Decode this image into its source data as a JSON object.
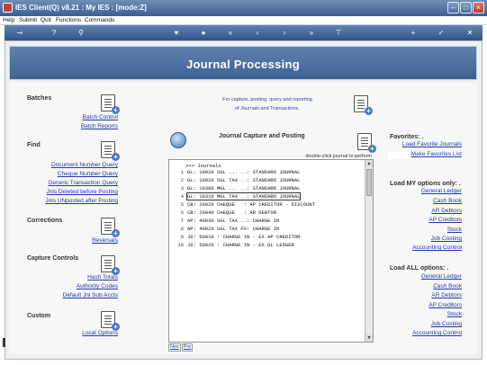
{
  "window": {
    "title": "IES Client(Q) v8.21 : My IES :       [mode:Z]",
    "controls": [
      "–",
      "□",
      "×"
    ]
  },
  "menu": [
    "Help",
    "Submit",
    "Quit",
    "Functions",
    "Commands"
  ],
  "toolbar": {
    "icons": [
      "key-icon",
      "help-icon",
      "search-icon",
      "heart-icon",
      "record-icon",
      "rewind-icon",
      "back-icon",
      "forward-icon",
      "fast-forward-icon",
      "skip-icon",
      "add-icon",
      "check-icon",
      "close-icon"
    ],
    "glyphs": [
      "⊸",
      "?",
      "⚲",
      "♥",
      "●",
      "«",
      "‹",
      "›",
      "»",
      "⊤",
      "+",
      "✓",
      "✕"
    ]
  },
  "banner": {
    "title": "Journal Processing"
  },
  "left": {
    "batches": {
      "title": "Batches",
      "links": [
        "Batch Control",
        "Batch Reports"
      ]
    },
    "find": {
      "title": "Find",
      "links": [
        "Document Number Query",
        "Cheque Number Query",
        "Generic Transaction Query",
        "Jnls Deleted before Posting",
        "Jnls UNposted after Posting"
      ]
    },
    "corrections": {
      "title": "Corrections",
      "links": [
        "Reversals"
      ]
    },
    "capture_controls": {
      "title": "Capture Controls",
      "links": [
        "Hash Totals",
        "Authority Codes",
        "Default Jnl Sub Accts"
      ]
    },
    "custom": {
      "title": "Custom",
      "links": [
        "Local Options"
      ]
    }
  },
  "center": {
    "info_line1": "For capture, posting, query and reporting",
    "info_line2": "of Journals and Transactions.",
    "capture_title": "Journal Capture and Posting",
    "hint": "double-click journal to perform",
    "list_header": ">>> Journals",
    "rows": [
      {
        "n": "1",
        "text": "GL: 10010 SGL ... ..: STANDARD JOURNAL"
      },
      {
        "n": "2",
        "text": "GL: 10020 SGL TAX ..: STANDARD JOURNAL"
      },
      {
        "n": "3",
        "text": "GL: 10300 MGL ... ..: STANDARD JOURNAL"
      },
      {
        "n": "4",
        "text": "GL: 10310 MGL TAX ..: STANDARD JOURNAL"
      },
      {
        "n": "5",
        "text": "CB: 20020 CHEQUE   : AP CREDITOR - DISCOUNT"
      },
      {
        "n": "6",
        "text": "CB: 20040 CHEQUE   : AR DEBTOR"
      },
      {
        "n": "7",
        "text": "AP: 40030 SGL TAX ..: CHARGE IN"
      },
      {
        "n": "8",
        "text": "AP: 40020 SGL TAX FX: CHARGE IN"
      },
      {
        "n": "9",
        "text": "J0: 50010 : CHARGE IN - EX AP CREDITOR"
      },
      {
        "n": "10",
        "text": "J0: 50020 : CHARGE IN - EX GL LEDGER"
      }
    ],
    "nav": [
      "Nex",
      "Pre"
    ]
  },
  "right": {
    "favorites": {
      "title": "Favorites: .",
      "links": [
        "Load Favorite Journals",
        "Make Favorites List"
      ]
    },
    "my_options": {
      "title": "Load MY options only: .",
      "links": [
        "General Ledger",
        "Cash Book",
        "AR Debtors",
        "AP Creditors",
        "Stock",
        "Job Costing",
        "Accounting Control"
      ]
    },
    "all_options": {
      "title": "Load ALL options: .",
      "links": [
        "General Ledger",
        "Cash Book",
        "AR Debtors",
        "AP Creditors",
        "Stock",
        "Job Costing",
        "Accounting Control"
      ]
    }
  }
}
